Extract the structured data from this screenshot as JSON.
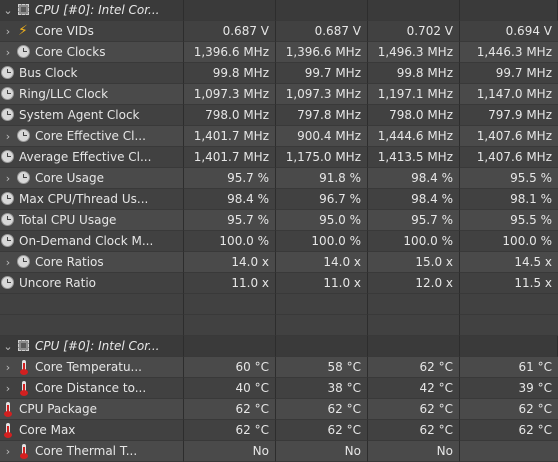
{
  "groups": [
    {
      "header": "CPU [#0]: Intel Cor...",
      "rows": [
        {
          "label": "Core VIDs",
          "icon": "bolt",
          "expand": true,
          "values": [
            "0.687 V",
            "0.687 V",
            "0.702 V",
            "0.694 V"
          ]
        },
        {
          "label": "Core Clocks",
          "icon": "clock",
          "expand": true,
          "values": [
            "1,396.6 MHz",
            "1,396.6 MHz",
            "1,496.3 MHz",
            "1,446.3 MHz"
          ]
        },
        {
          "label": "Bus Clock",
          "icon": "clock",
          "expand": false,
          "values": [
            "99.8 MHz",
            "99.7 MHz",
            "99.8 MHz",
            "99.7 MHz"
          ]
        },
        {
          "label": "Ring/LLC Clock",
          "icon": "clock",
          "expand": false,
          "values": [
            "1,097.3 MHz",
            "1,097.3 MHz",
            "1,197.1 MHz",
            "1,147.0 MHz"
          ]
        },
        {
          "label": "System Agent Clock",
          "icon": "clock",
          "expand": false,
          "values": [
            "798.0 MHz",
            "797.8 MHz",
            "798.0 MHz",
            "797.9 MHz"
          ]
        },
        {
          "label": "Core Effective Cl...",
          "icon": "clock",
          "expand": true,
          "values": [
            "1,401.7 MHz",
            "900.4 MHz",
            "1,444.6 MHz",
            "1,407.6 MHz"
          ]
        },
        {
          "label": "Average Effective Cl...",
          "icon": "clock",
          "expand": false,
          "values": [
            "1,401.7 MHz",
            "1,175.0 MHz",
            "1,413.5 MHz",
            "1,407.6 MHz"
          ]
        },
        {
          "label": "Core Usage",
          "icon": "clock",
          "expand": true,
          "values": [
            "95.7 %",
            "91.8 %",
            "98.4 %",
            "95.5 %"
          ]
        },
        {
          "label": "Max CPU/Thread Us...",
          "icon": "clock",
          "expand": false,
          "values": [
            "98.4 %",
            "96.7 %",
            "98.4 %",
            "98.1 %"
          ]
        },
        {
          "label": "Total CPU Usage",
          "icon": "clock",
          "expand": false,
          "values": [
            "95.7 %",
            "95.0 %",
            "95.7 %",
            "95.5 %"
          ]
        },
        {
          "label": "On-Demand Clock M...",
          "icon": "clock",
          "expand": false,
          "values": [
            "100.0 %",
            "100.0 %",
            "100.0 %",
            "100.0 %"
          ]
        },
        {
          "label": "Core Ratios",
          "icon": "clock",
          "expand": true,
          "values": [
            "14.0 x",
            "14.0 x",
            "15.0 x",
            "14.5 x"
          ]
        },
        {
          "label": "Uncore Ratio",
          "icon": "clock",
          "expand": false,
          "values": [
            "11.0 x",
            "11.0 x",
            "12.0 x",
            "11.5 x"
          ]
        }
      ]
    },
    {
      "header": "CPU [#0]: Intel Cor...",
      "rows": [
        {
          "label": "Core Temperatu...",
          "icon": "therm",
          "expand": true,
          "values": [
            "60 °C",
            "58 °C",
            "62 °C",
            "61 °C"
          ]
        },
        {
          "label": "Core Distance to...",
          "icon": "therm",
          "expand": true,
          "values": [
            "40 °C",
            "38 °C",
            "42 °C",
            "39 °C"
          ]
        },
        {
          "label": "CPU Package",
          "icon": "therm",
          "expand": false,
          "values": [
            "62 °C",
            "62 °C",
            "62 °C",
            "62 °C"
          ]
        },
        {
          "label": "Core Max",
          "icon": "therm",
          "expand": false,
          "values": [
            "62 °C",
            "62 °C",
            "62 °C",
            "62 °C"
          ]
        },
        {
          "label": "Core Thermal T...",
          "icon": "therm",
          "expand": true,
          "values": [
            "No",
            "No",
            "No",
            ""
          ]
        }
      ]
    }
  ]
}
